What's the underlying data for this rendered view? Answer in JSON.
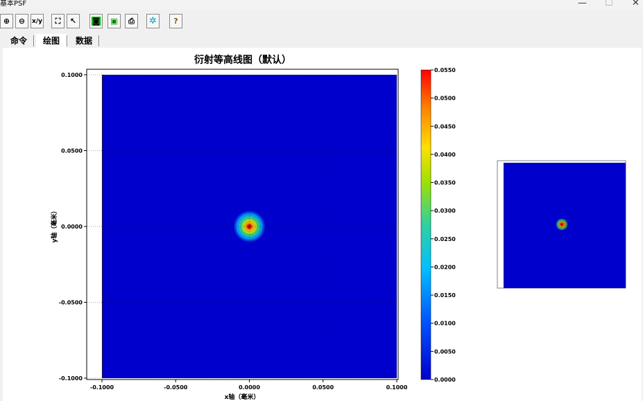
{
  "window": {
    "title": "基本PSF",
    "minimize_glyph": "—",
    "maximize_glyph": "☐",
    "close_glyph": "✕"
  },
  "toolbar": {
    "buttons": [
      {
        "name": "zoom-in-icon",
        "glyph": "⊕"
      },
      {
        "name": "zoom-out-icon",
        "glyph": "⊖"
      },
      {
        "name": "xy-axis-icon",
        "glyph": "x/y"
      },
      {
        "name": "fit-view-icon",
        "glyph": "⛶"
      },
      {
        "name": "pointer-icon",
        "glyph": "↖"
      },
      {
        "name": "camera-icon",
        "glyph": "◙"
      },
      {
        "name": "save-icon",
        "glyph": "▣"
      },
      {
        "name": "print-icon",
        "glyph": "⎙"
      },
      {
        "name": "gear-icon",
        "glyph": "✲"
      },
      {
        "name": "help-icon",
        "glyph": "?"
      }
    ]
  },
  "tabs": [
    {
      "label": "命令",
      "active": false
    },
    {
      "label": "绘图",
      "active": true
    },
    {
      "label": "数据",
      "active": false
    }
  ],
  "chart_data": {
    "type": "heatmap",
    "title": "衍射等高线图（默认）",
    "xlabel": "x轴（毫米）",
    "ylabel": "y轴（毫米）",
    "xlim": [
      -0.1,
      0.1
    ],
    "ylim": [
      -0.1,
      0.1
    ],
    "x_ticks": [
      "-0.1000",
      "-0.0500",
      "0.0000",
      "0.0500",
      "0.1000"
    ],
    "y_ticks": [
      "0.1000",
      "0.0500",
      "0.0000",
      "-0.0500",
      "-0.1000"
    ],
    "peak": {
      "x": 0.0,
      "y": 0.0,
      "value": 0.055
    },
    "colorbar": {
      "min": 0.0,
      "max": 0.055,
      "ticks": [
        "0.0550",
        "0.0500",
        "0.0450",
        "0.0400",
        "0.0350",
        "0.0300",
        "0.0250",
        "0.0200",
        "0.0150",
        "0.0100",
        "0.0050",
        "0.0000"
      ]
    },
    "colors": {
      "background_field": "#0000cc",
      "peak": "#cc0000"
    }
  }
}
